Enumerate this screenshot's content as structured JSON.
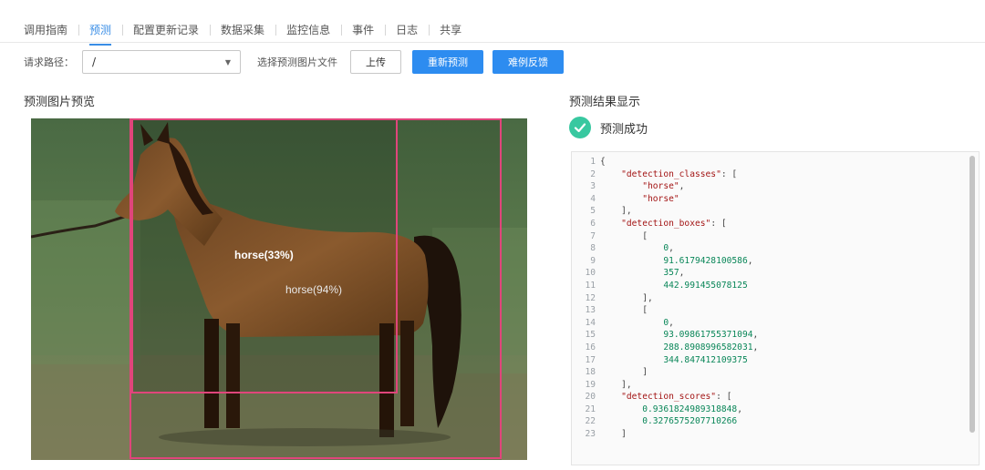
{
  "tabs": [
    {
      "label": "调用指南"
    },
    {
      "label": "预测"
    },
    {
      "label": "配置更新记录"
    },
    {
      "label": "数据采集"
    },
    {
      "label": "监控信息"
    },
    {
      "label": "事件"
    },
    {
      "label": "日志"
    },
    {
      "label": "共享"
    }
  ],
  "active_tab_index": 1,
  "toolbar": {
    "request_path_label": "请求路径：",
    "request_path_value": "/",
    "select_file_label": "选择预测图片文件",
    "upload_label": "上传",
    "repredict_label": "重新预测",
    "feedback_label": "难例反馈"
  },
  "preview": {
    "title": "预测图片预览",
    "detections": [
      {
        "label": "horse(33%)"
      },
      {
        "label": "horse(94%)"
      }
    ],
    "box_color": "#e0457b"
  },
  "result": {
    "title": "预测结果显示",
    "status_text": "预测成功",
    "status_color": "#38c8a0",
    "json_lines": [
      "{",
      "    \"detection_classes\": [",
      "        \"horse\",",
      "        \"horse\"",
      "    ],",
      "    \"detection_boxes\": [",
      "        [",
      "            0,",
      "            91.6179428100586,",
      "            357,",
      "            442.991455078125",
      "        ],",
      "        [",
      "            0,",
      "            93.09861755371094,",
      "            288.8908996582031,",
      "            344.847412109375",
      "        ]",
      "    ],",
      "    \"detection_scores\": [",
      "        0.9361824989318848,",
      "        0.3276575207710266",
      "    ]"
    ]
  },
  "colors": {
    "accent": "#2d8cf0",
    "tab_active": "#3a8ee6"
  }
}
